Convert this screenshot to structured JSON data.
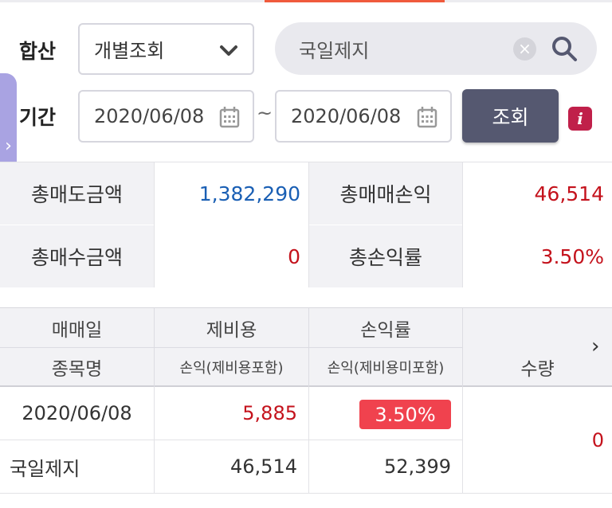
{
  "filters": {
    "sum_label": "합산",
    "mode_select": "개별조회",
    "search_value": "국일제지",
    "period_label": "기간",
    "date_from": "2020/06/08",
    "date_to": "2020/06/08",
    "tilde": "~",
    "query_button": "조회",
    "info_glyph": "i"
  },
  "summary": {
    "total_sell_label": "총매도금액",
    "total_sell_value": "1,382,290",
    "total_pnl_label": "총매매손익",
    "total_pnl_value": "46,514",
    "total_receive_label": "총매수금액",
    "total_receive_value": "0",
    "total_rate_label": "총손익률",
    "total_rate_value": "3.50%"
  },
  "table": {
    "headers": {
      "trade_date": "매매일",
      "fees": "제비용",
      "pnl_rate": "손익률",
      "stock_name": "종목명",
      "pnl_incl_fees": "손익(제비용포함)",
      "pnl_excl_fees": "손익(제비용미포함)",
      "quantity": "수량"
    },
    "rows": [
      {
        "trade_date": "2020/06/08",
        "fees": "5,885",
        "pnl_rate": "3.50%",
        "stock_name": "국일제지",
        "pnl_incl_fees": "46,514",
        "pnl_excl_fees": "52,399",
        "quantity": "0"
      }
    ]
  },
  "colors": {
    "accent": "#f05a3c",
    "side_tab": "#a9a3e2",
    "query_button": "#555870",
    "info": "#c0204a",
    "positive": "#c4121c",
    "negative": "#1a5fb4",
    "rate_badge": "#f0424e"
  },
  "icons": [
    "chevron-down-icon",
    "clear-icon",
    "search-icon",
    "calendar-icon",
    "info-icon",
    "chevron-right-icon"
  ]
}
